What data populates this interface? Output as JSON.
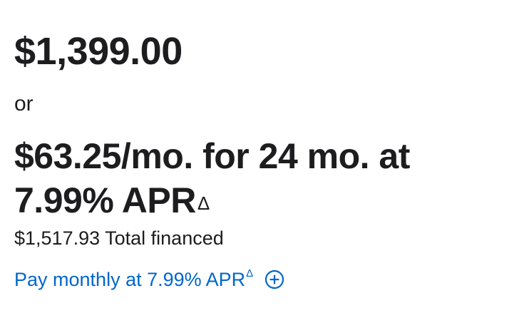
{
  "price": {
    "full": "$1,399.00",
    "or_label": "or",
    "monthly_line": "$63.25/mo. for 24 mo. at 7.99% APR",
    "monthly_footnote": "Δ",
    "total_financed": "$1,517.93 Total financed"
  },
  "link": {
    "label": "Pay monthly at 7.99% APR",
    "footnote": "Δ",
    "icon": "plus-circle-icon",
    "color": "#0066cc"
  }
}
